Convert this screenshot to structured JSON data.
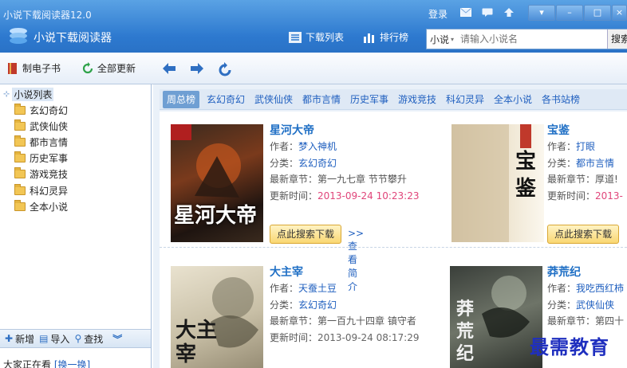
{
  "window": {
    "version_title": "小说下载阅读器12.0",
    "app_name": "小说下载阅读器",
    "login": "登录",
    "title_icons": [
      "mail-icon",
      "message-icon",
      "upload-icon"
    ],
    "window_controls": [
      "menu-icon",
      "minimize-icon",
      "maximize-icon",
      "close-icon"
    ]
  },
  "nav": {
    "download_list": "下载列表",
    "ranking": "排行榜"
  },
  "search": {
    "category": "小说",
    "placeholder": "请输入小说名",
    "button": "搜索"
  },
  "toolbar": {
    "make_ebook": "制电子书",
    "update_all": "全部更新"
  },
  "sidebar": {
    "root": "小说列表",
    "items": [
      {
        "label": "玄幻奇幻"
      },
      {
        "label": "武侠仙侠"
      },
      {
        "label": "都市言情"
      },
      {
        "label": "历史军事"
      },
      {
        "label": "游戏竞技"
      },
      {
        "label": "科幻灵异"
      },
      {
        "label": "全本小说"
      }
    ],
    "actions": {
      "add": "新增",
      "import": "导入",
      "find": "查找"
    },
    "watching": "大家正在看",
    "swap": "[换一换]"
  },
  "tabs": [
    {
      "label": "周总榜",
      "active": true
    },
    {
      "label": "玄幻奇幻"
    },
    {
      "label": "武侠仙侠"
    },
    {
      "label": "都市言情"
    },
    {
      "label": "历史军事"
    },
    {
      "label": "游戏竞技"
    },
    {
      "label": "科幻灵异"
    },
    {
      "label": "全本小说"
    },
    {
      "label": "各书站榜"
    }
  ],
  "labels": {
    "author": "作者：",
    "category": "分类：",
    "latest": "最新章节：",
    "updated": "更新时间：",
    "download_btn": "点此搜索下载",
    "intro_link": ">>查看简介"
  },
  "books": [
    {
      "title": "星河大帝",
      "author": "梦入神机",
      "category": "玄幻奇幻",
      "latest": "第一九七章 节节攀升",
      "updated": "2013-09-24 10:23:23",
      "cover_text": "星河大帝"
    },
    {
      "title": "宝鉴",
      "author": "打眼",
      "category": "都市言情",
      "latest": "厚道!",
      "updated": "2013-",
      "cover_text": "宝鉴"
    },
    {
      "title": "大主宰",
      "author": "天蚕土豆",
      "category": "玄幻奇幻",
      "latest": "第一百九十四章 镇守者",
      "updated": "2013-09-24 08:17:29",
      "cover_text": "大主宰"
    },
    {
      "title": "莽荒纪",
      "author": "我吃西红柿",
      "category": "武侠仙侠",
      "latest": "第四十",
      "updated": "",
      "cover_text": "莽荒纪"
    }
  ],
  "watermark": "最需教育",
  "colors": {
    "titlebar": "#2d79cf",
    "accent_link": "#1f5fbf",
    "time_text": "#e0457a",
    "active_tab": "#6f9fd3"
  }
}
